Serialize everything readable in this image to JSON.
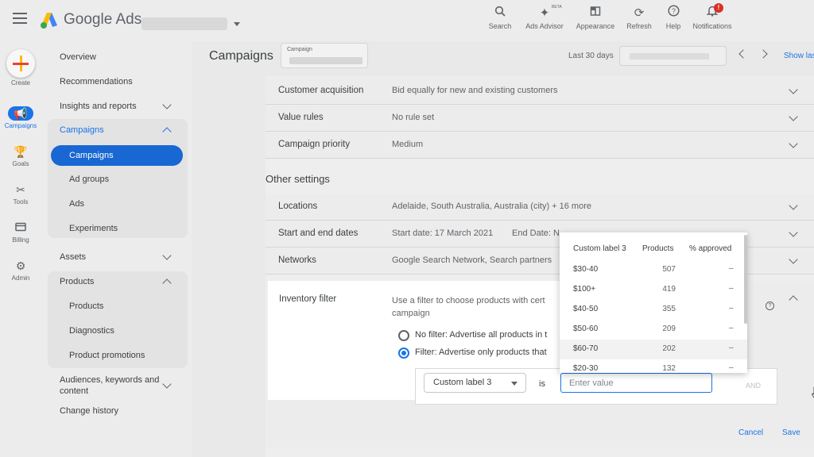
{
  "header": {
    "brand": "Google Ads",
    "items": [
      {
        "label": "Search",
        "icon": "search-icon"
      },
      {
        "label": "Ads Advisor",
        "icon": "sparkle-icon",
        "badge": "BETA"
      },
      {
        "label": "Appearance",
        "icon": "appearance-icon"
      },
      {
        "label": "Refresh",
        "icon": "refresh-icon"
      },
      {
        "label": "Help",
        "icon": "help-icon"
      },
      {
        "label": "Notifications",
        "icon": "bell-icon",
        "badge": "!"
      }
    ]
  },
  "rail": {
    "create": "Create",
    "items": [
      {
        "label": "Campaigns",
        "icon": "megaphone-icon",
        "active": true
      },
      {
        "label": "Goals",
        "icon": "trophy-icon"
      },
      {
        "label": "Tools",
        "icon": "tools-icon"
      },
      {
        "label": "Billing",
        "icon": "card-icon"
      },
      {
        "label": "Admin",
        "icon": "gear-icon"
      }
    ]
  },
  "nav": {
    "overview": "Overview",
    "recommendations": "Recommendations",
    "insights": "Insights and reports",
    "campaigns_group": "Campaigns",
    "campaigns_active": "Campaigns",
    "ad_groups": "Ad groups",
    "ads": "Ads",
    "experiments": "Experiments",
    "assets": "Assets",
    "products_group": "Products",
    "products": "Products",
    "diagnostics": "Diagnostics",
    "product_promotions": "Product promotions",
    "audiences": "Audiences, keywords and content",
    "change_history": "Change history"
  },
  "main": {
    "title": "Campaigns",
    "campaign_chip_label": "Campaign",
    "date_range": "Last 30 days",
    "show_last": "Show last",
    "settings_rows": [
      {
        "key": "Customer acquisition",
        "value": "Bid equally for new and existing customers"
      },
      {
        "key": "Value rules",
        "value": "No rule set"
      },
      {
        "key": "Campaign priority",
        "value": "Medium"
      }
    ],
    "other_settings_title": "Other settings",
    "other_rows": [
      {
        "key": "Locations",
        "value": "Adelaide, South Australia, Australia (city) + 16 more"
      },
      {
        "key": "Start and end dates",
        "value": "Start date: 17 March 2021",
        "value2": "End Date: N"
      },
      {
        "key": "Networks",
        "value": "Google Search Network, Search partners"
      }
    ],
    "inventory": {
      "label": "Inventory filter",
      "description": "Use a filter to choose products with cert campaign",
      "desc_line1": "Use a filter to choose products with cert",
      "desc_line2": "campaign",
      "option_none": "No filter: Advertise all products in t",
      "option_filter": "Filter: Advertise only products that",
      "select_value": "Custom label 3",
      "is": "is",
      "input_placeholder": "Enter value",
      "and": "AND",
      "cancel": "Cancel",
      "save": "Save"
    }
  },
  "dropdown": {
    "headers": [
      "Custom label 3",
      "Products",
      "% approved"
    ],
    "rows": [
      {
        "label": "$30-40",
        "products": "507",
        "approved": "–"
      },
      {
        "label": "$100+",
        "products": "419",
        "approved": "–"
      },
      {
        "label": "$40-50",
        "products": "355",
        "approved": "–"
      },
      {
        "label": "$50-60",
        "products": "209",
        "approved": "–"
      },
      {
        "label": "$60-70",
        "products": "202",
        "approved": "–"
      },
      {
        "label": "$20-30",
        "products": "132",
        "approved": "–"
      }
    ]
  },
  "colors": {
    "accent": "#1a73e8",
    "active_nav": "#1967d2",
    "badge": "#d93025"
  }
}
